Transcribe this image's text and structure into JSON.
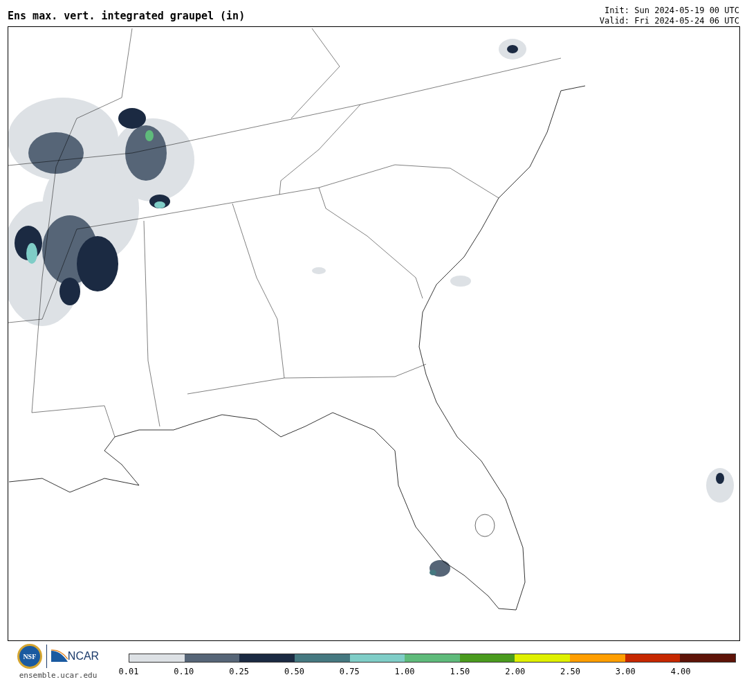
{
  "title": "Ens max. vert. integrated graupel (in)",
  "init": "Init: Sun 2024-05-19 00 UTC",
  "valid": "Valid: Fri 2024-05-24 06 UTC",
  "logos": {
    "nsf": "NSF",
    "ncar": "NCAR",
    "url": "ensemble.ucar.edu"
  },
  "colorbar": {
    "bins": [
      {
        "label": "0.01",
        "color": "#dde1e5"
      },
      {
        "label": "0.10",
        "color": "#566577"
      },
      {
        "label": "0.25",
        "color": "#1b2a42"
      },
      {
        "label": "0.50",
        "color": "#457880"
      },
      {
        "label": "0.75",
        "color": "#7fcdc7"
      },
      {
        "label": "1.00",
        "color": "#5fbb7b"
      },
      {
        "label": "1.50",
        "color": "#4a9b1e"
      },
      {
        "label": "2.00",
        "color": "#dff000"
      },
      {
        "label": "2.50",
        "color": "#ff9e00"
      },
      {
        "label": "3.00",
        "color": "#c62800"
      },
      {
        "label": "4.00",
        "color": "#5e1408"
      }
    ]
  }
}
